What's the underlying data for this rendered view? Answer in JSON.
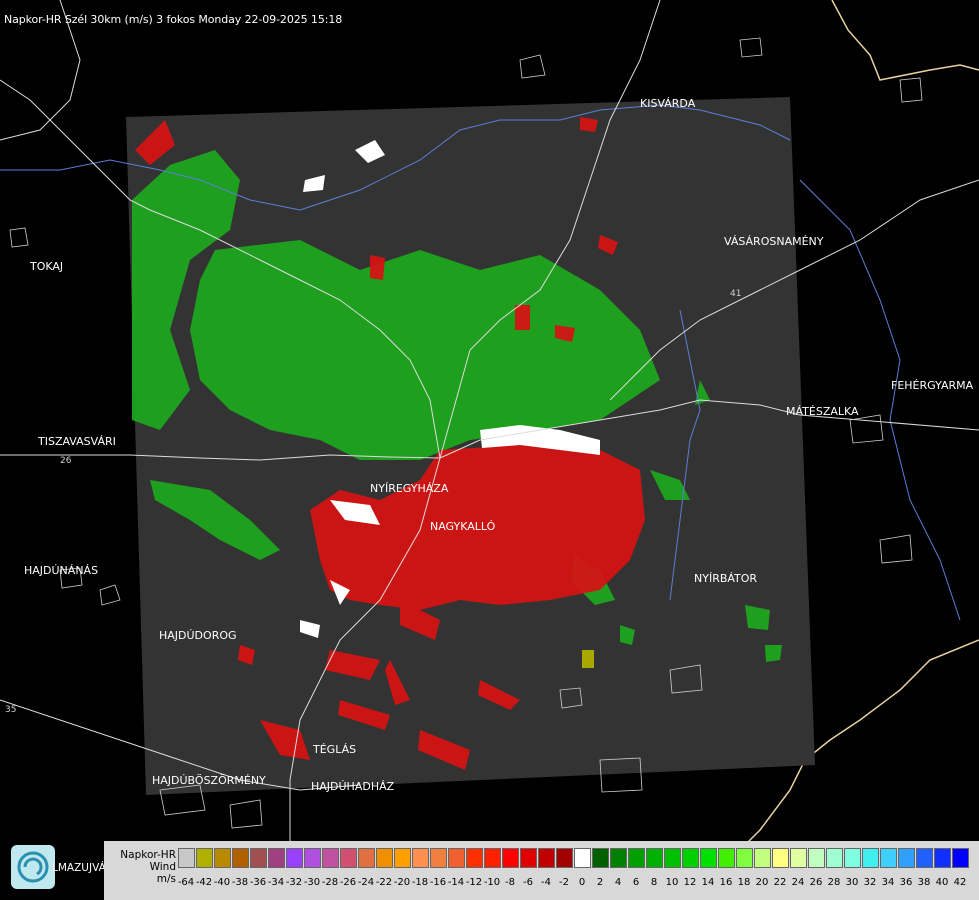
{
  "header": {
    "title": "Napkor-HR Szél 30km (m/s) 3 fokos Monday 22-09-2025 15:18"
  },
  "towns": {
    "kisvarda": "KISVÁRDA",
    "tokaj": "TOKAJ",
    "vasarosnameny": "VÁSÁROSNAMÉNY",
    "fehergyarmat": "FEHÉRGYARMA",
    "mateszalka": "MÁTÉSZALKA",
    "tiszavasvari": "TISZAVASVÁRI",
    "nyiregyhaza": "NYÍREGYHÁZA",
    "nagykallo": "NAGYKALLÓ",
    "hajdunanas": "HAJDÚNÁNÁS",
    "nyirbator": "NYÍRBÁTOR",
    "hajdudorog": "HAJDÚDOROG",
    "teglas": "TÉGLÁS",
    "hajduboszormeny": "HAJDÚBÖSZÖRMÉNY",
    "hajduhadhaz": "HAJDÚHADHÁZ"
  },
  "roads": {
    "r26": "26",
    "r35": "35",
    "r41": "41"
  },
  "logo": {
    "text": "LMAZUJVÁR",
    "icon": "napkor-logo-icon"
  },
  "legend": {
    "title_line1": "Napkor-HR",
    "title_line2": "Wind",
    "title_line3": "m/s",
    "colors": [
      "#c8c8c8",
      "#b0b000",
      "#b88a00",
      "#b06000",
      "#a05050",
      "#a04080",
      "#9a40ff",
      "#b050e0",
      "#c050a0",
      "#d05070",
      "#e07040",
      "#f09000",
      "#ffa000",
      "#ff9050",
      "#f08040",
      "#f06030",
      "#ff3000",
      "#ff2000",
      "#ff0000",
      "#e00000",
      "#c00000",
      "#a00000",
      "#ffffff",
      "#006000",
      "#008000",
      "#00a000",
      "#00b000",
      "#00c000",
      "#00d000",
      "#00e000",
      "#40f000",
      "#80ff40",
      "#c0ff80",
      "#ffff80",
      "#e0ffa0",
      "#c0ffc0",
      "#a0ffd0",
      "#80ffe0",
      "#40f0f0",
      "#40d0ff",
      "#30a0ff",
      "#2060ff",
      "#1030ff",
      "#0000ff"
    ],
    "ticks": [
      "-64",
      "-42",
      "-40",
      "-38",
      "-36",
      "-34",
      "-32",
      "-30",
      "-28",
      "-26",
      "-24",
      "-22",
      "-20",
      "-18",
      "-16",
      "-14",
      "-12",
      "-10",
      "-8",
      "-6",
      "-4",
      "-2",
      "0",
      "2",
      "4",
      "6",
      "8",
      "10",
      "12",
      "14",
      "16",
      "18",
      "20",
      "22",
      "24",
      "26",
      "28",
      "30",
      "32",
      "34",
      "36",
      "38",
      "40",
      "42"
    ]
  }
}
